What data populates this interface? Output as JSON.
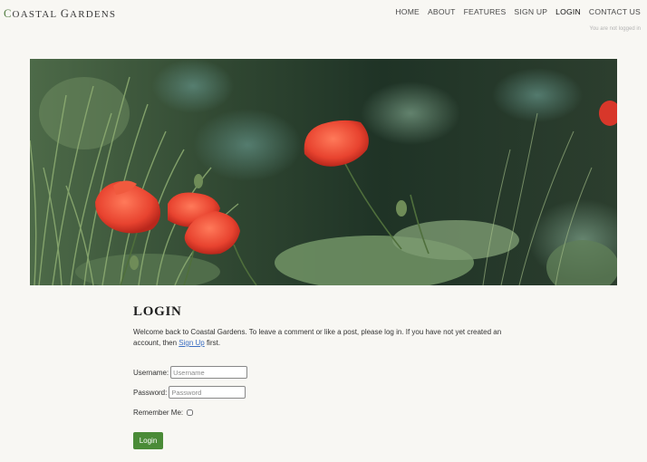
{
  "brand": {
    "first_letter": "C",
    "rest": "OASTAL",
    "second_first": "G",
    "second_rest": "ARDENS"
  },
  "nav": {
    "items": [
      {
        "label": "HOME"
      },
      {
        "label": "ABOUT"
      },
      {
        "label": "FEATURES"
      },
      {
        "label": "SIGN UP"
      },
      {
        "label": "LOGIN"
      },
      {
        "label": "CONTACT US"
      }
    ],
    "active": "LOGIN"
  },
  "status": {
    "text": "You are not logged in"
  },
  "hero": {
    "icon": "poppy-field-image"
  },
  "login": {
    "title": "LOGIN",
    "intro_before": "Welcome back to Coastal Gardens. To leave a comment or like a post, please log in. If you have not yet created an account, then ",
    "intro_link": "Sign Up",
    "intro_after": " first.",
    "username_label": "Username:",
    "username_placeholder": "Username",
    "username_value": "",
    "password_label": "Password:",
    "password_placeholder": "Password",
    "password_value": "",
    "remember_label": "Remember Me:",
    "remember_checked": false,
    "submit_label": "Login"
  },
  "colors": {
    "background": "#f8f7f3",
    "accent": "#4a8b37",
    "link": "#3c6fc2",
    "poppy": "#e8432f"
  }
}
